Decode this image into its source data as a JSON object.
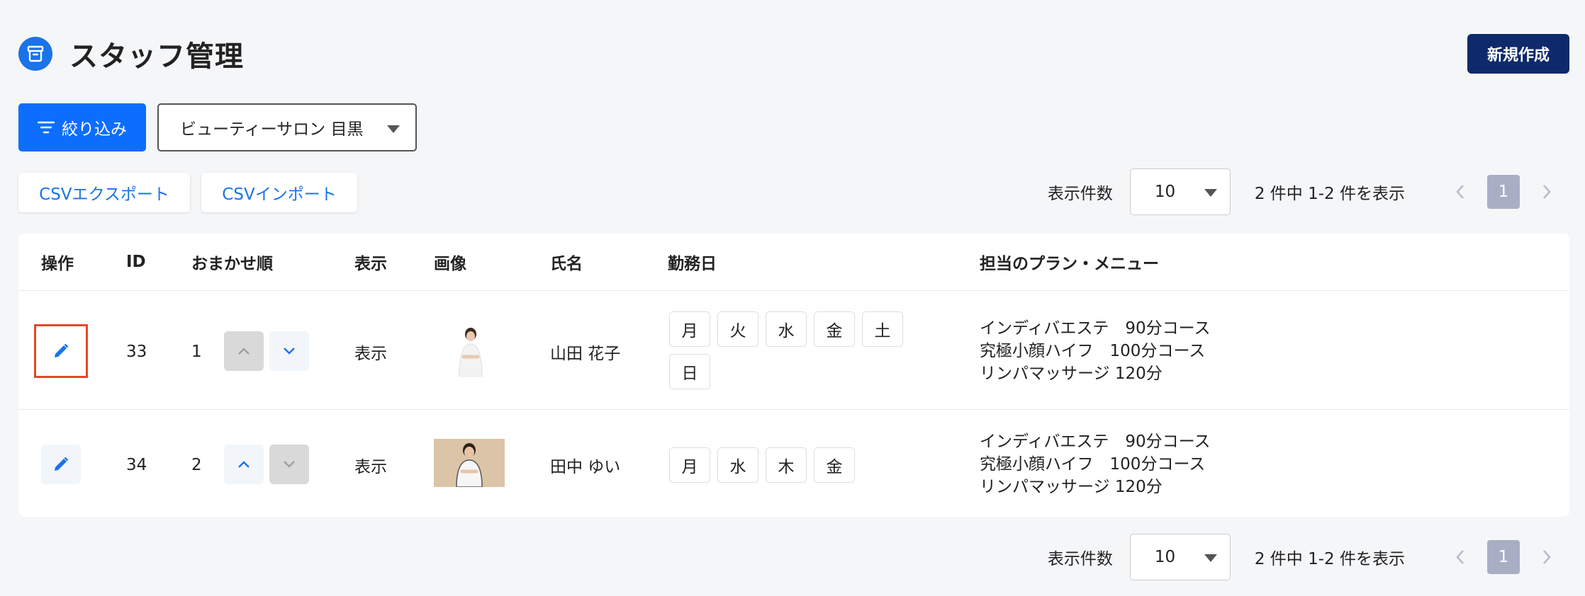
{
  "header": {
    "title": "スタッフ管理",
    "new_button": "新規作成"
  },
  "filters": {
    "filter_button": "絞り込み",
    "salon_select": "ビューティーサロン 目黒"
  },
  "csv": {
    "export_label": "CSVエクスポート",
    "import_label": "CSVインポート"
  },
  "pagination": {
    "per_page_label": "表示件数",
    "per_page_value": "10",
    "count_text": "2 件中  1-2 件を表示",
    "current_page": "1"
  },
  "table": {
    "columns": [
      "操作",
      "ID",
      "おまかせ順",
      "表示",
      "画像",
      "氏名",
      "勤務日",
      "担当のプラン・メニュー"
    ],
    "rows": [
      {
        "id": "33",
        "order": "1",
        "visibility": "表示",
        "name": "山田 花子",
        "days": [
          "月",
          "火",
          "水",
          "金",
          "土",
          "日"
        ],
        "menus": [
          "インディバエステ　90分コース",
          "究極小顔ハイフ　100分コース",
          "リンパマッサージ 120分"
        ],
        "up_enabled": false,
        "down_enabled": true
      },
      {
        "id": "34",
        "order": "2",
        "visibility": "表示",
        "name": "田中 ゆい",
        "days": [
          "月",
          "水",
          "木",
          "金"
        ],
        "menus": [
          "インディバエステ　90分コース",
          "究極小顔ハイフ　100分コース",
          "リンパマッサージ 120分"
        ],
        "up_enabled": true,
        "down_enabled": false
      }
    ]
  },
  "colors": {
    "primary": "#0d6efd",
    "navy": "#0e2a6b",
    "highlight": "#e8452c"
  }
}
